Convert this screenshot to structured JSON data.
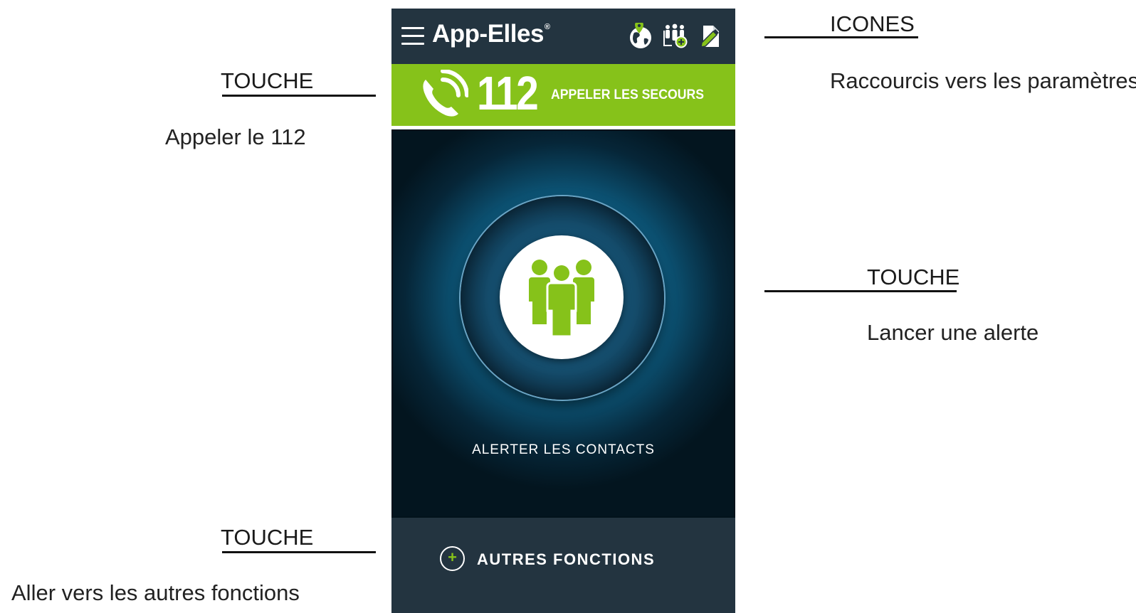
{
  "annotations": {
    "icons": {
      "title": "ICONES",
      "description": "Raccourcis vers les paramètres"
    },
    "call": {
      "title": "TOUCHE",
      "description": "Appeler le 112"
    },
    "alert": {
      "title": "TOUCHE",
      "description": "Lancer une alerte"
    },
    "more": {
      "title": "TOUCHE",
      "description": "Aller vers les autres fonctions"
    }
  },
  "app": {
    "name": "App-Elles",
    "trademark": "®",
    "header_icons": [
      "globe-location-icon",
      "group-add-icon",
      "edit-document-icon"
    ],
    "call_button": {
      "number": "112",
      "label": "APPELER LES SECOURS"
    },
    "alert_button": {
      "label": "ALERTER LES CONTACTS",
      "icon": "contacts-group-icon"
    },
    "more_button": {
      "label": "AUTRES FONCTIONS",
      "icon": "plus-circle-icon"
    }
  },
  "colors": {
    "header_bg": "#233440",
    "call_bar": "#86c21a",
    "accent_green": "#86c21a",
    "alert_glow": "#3fb7e6"
  }
}
